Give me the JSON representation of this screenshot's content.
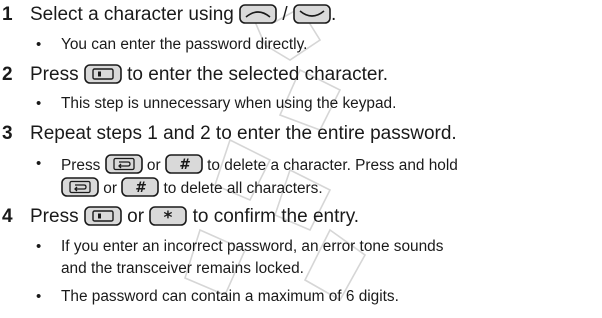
{
  "steps": [
    {
      "number": "1",
      "text_before": "Select a character using ",
      "keys": [
        "up-arrow-key-icon",
        "down-arrow-key-icon"
      ],
      "separator": " / ",
      "text_after": ".",
      "notes": [
        "You can enter the password directly."
      ]
    },
    {
      "number": "2",
      "text_before": "Press ",
      "keys": [
        "select-key-icon"
      ],
      "text_after": " to enter the selected character.",
      "notes": [
        "This step is unnecessary when using the keypad."
      ]
    },
    {
      "number": "3",
      "text": "Repeat steps 1 and 2 to enter the entire password.",
      "notes": [
        {
          "line1_before": "Press ",
          "line1_or": " or ",
          "line1_after": " to delete a character.  Press and hold",
          "line2_or": " or ",
          "line2_after": " to delete all characters.",
          "keys": [
            "back-key-icon",
            "hash-key-icon"
          ]
        }
      ]
    },
    {
      "number": "4",
      "text_before": "Press ",
      "or": " or ",
      "text_after": " to confirm the entry.",
      "keys": [
        "select-key-icon",
        "asterisk-key-icon"
      ],
      "notes": [
        {
          "line1": "If you enter an incorrect password, an error tone sounds",
          "line2": "and the transceiver remains locked."
        },
        "The password can contain a maximum of 6 digits."
      ]
    }
  ],
  "colors": {
    "text": "#1a1a1a",
    "key_fill": "#d9d9d9",
    "watermark": "#d6d6d6"
  }
}
